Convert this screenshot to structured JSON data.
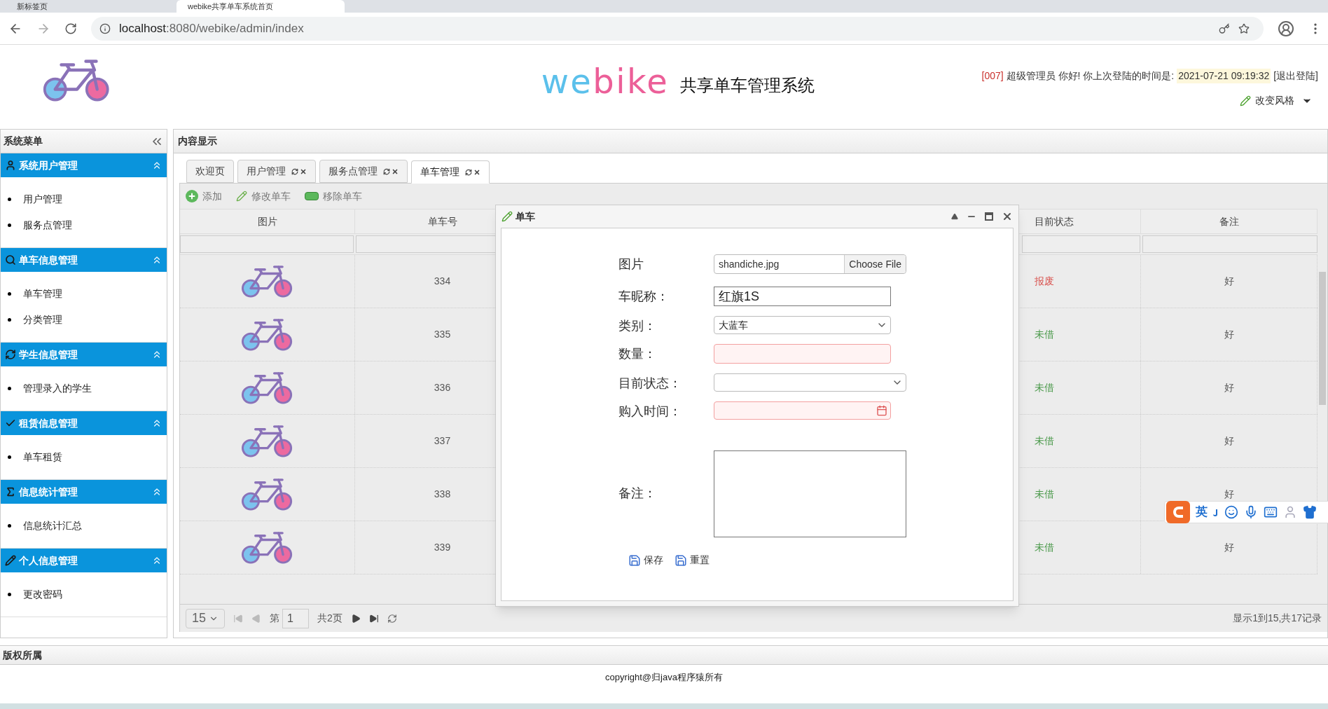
{
  "browser": {
    "tabs": [
      {
        "title": "新标签页",
        "selected": false
      },
      {
        "title": "webike共享单车系统首页",
        "selected": true
      }
    ],
    "url_host": "localhost",
    "url_path": ":8080/webike/admin/index"
  },
  "header": {
    "logo_parts": [
      {
        "text": "we",
        "color": "#5bc0eb"
      },
      {
        "text": "bike",
        "color": "#ec5f98"
      }
    ],
    "subtitle": "共享单车管理系统",
    "user_id": "[007]",
    "greeting": "超级管理员 你好! 你上次登陆的时间是:",
    "last_login": "2021-07-21 09:19:32",
    "logout": "[退出登陆]",
    "theme_button": "改变风格"
  },
  "sidebar": {
    "title": "系统菜单",
    "sections": [
      {
        "title": "系统用户管理",
        "kind": "user",
        "expanded": true,
        "items": [
          "用户管理",
          "服务点管理"
        ]
      },
      {
        "title": "单车信息管理",
        "kind": "search",
        "expanded": true,
        "items": [
          "单车管理",
          "分类管理"
        ]
      },
      {
        "title": "学生信息管理",
        "kind": "refresh",
        "expanded": true,
        "items": [
          "管理录入的学生"
        ]
      },
      {
        "title": "租赁信息管理",
        "kind": "check",
        "expanded": true,
        "items": [
          "单车租赁"
        ]
      },
      {
        "title": "信息统计管理",
        "kind": "sigma",
        "expanded": true,
        "items": [
          "信息统计汇总"
        ]
      },
      {
        "title": "个人信息管理",
        "kind": "pencil",
        "expanded": true,
        "items": [
          "更改密码"
        ]
      }
    ]
  },
  "content": {
    "title": "内容显示",
    "tabs": [
      {
        "label": "欢迎页",
        "closable": false,
        "selected": false
      },
      {
        "label": "用户管理",
        "closable": true,
        "selected": false
      },
      {
        "label": "服务点管理",
        "closable": true,
        "selected": false
      },
      {
        "label": "单车管理",
        "closable": true,
        "selected": true
      }
    ],
    "toolbar": [
      {
        "label": "添加",
        "kind": "add"
      },
      {
        "label": "修改单车",
        "kind": "edit"
      },
      {
        "label": "移除单车",
        "kind": "remove"
      }
    ],
    "table": {
      "columns": [
        "图片",
        "单车号",
        "目前状态",
        "备注"
      ],
      "rows": [
        {
          "number": "334",
          "status": "报废",
          "color": "#d9534f",
          "remark": "好"
        },
        {
          "number": "335",
          "status": "未借",
          "color": "#4c9a4c",
          "remark": "好"
        },
        {
          "number": "336",
          "status": "未借",
          "color": "#4c9a4c",
          "remark": "好"
        },
        {
          "number": "337",
          "status": "未借",
          "color": "#4c9a4c",
          "remark": "好"
        },
        {
          "number": "338",
          "status": "未借",
          "color": "#4c9a4c",
          "remark": "好"
        },
        {
          "number": "339",
          "status": "未借",
          "color": "#4c9a4c",
          "remark": "好"
        }
      ]
    },
    "pager": {
      "page_size": "15",
      "page_label": "第",
      "page": "1",
      "total_pages": "共2页",
      "summary": "显示1到15,共17记录"
    }
  },
  "dialog": {
    "title": "单车",
    "fields": [
      {
        "kind": "file",
        "label": "图片",
        "value": "shandiche.jpg",
        "button": "Choose File",
        "invalid": false
      },
      {
        "kind": "text",
        "label": "车昵称：",
        "value": "红旗1S",
        "invalid": false
      },
      {
        "kind": "select",
        "label": "类别：",
        "value": "大蓝车",
        "invalid": false
      },
      {
        "kind": "text",
        "label": "数量：",
        "invalid": true
      },
      {
        "kind": "select",
        "label": "目前状态：",
        "invalid": false
      },
      {
        "kind": "date",
        "label": "购入时间：",
        "invalid": true
      },
      {
        "kind": "textarea",
        "label": "备注：",
        "invalid": false
      }
    ],
    "buttons": [
      "保存",
      "重置"
    ]
  },
  "ime": {
    "label": "英"
  },
  "footer": {
    "title": "版权所属",
    "copyright": "copyright@归java程序猿所有"
  }
}
